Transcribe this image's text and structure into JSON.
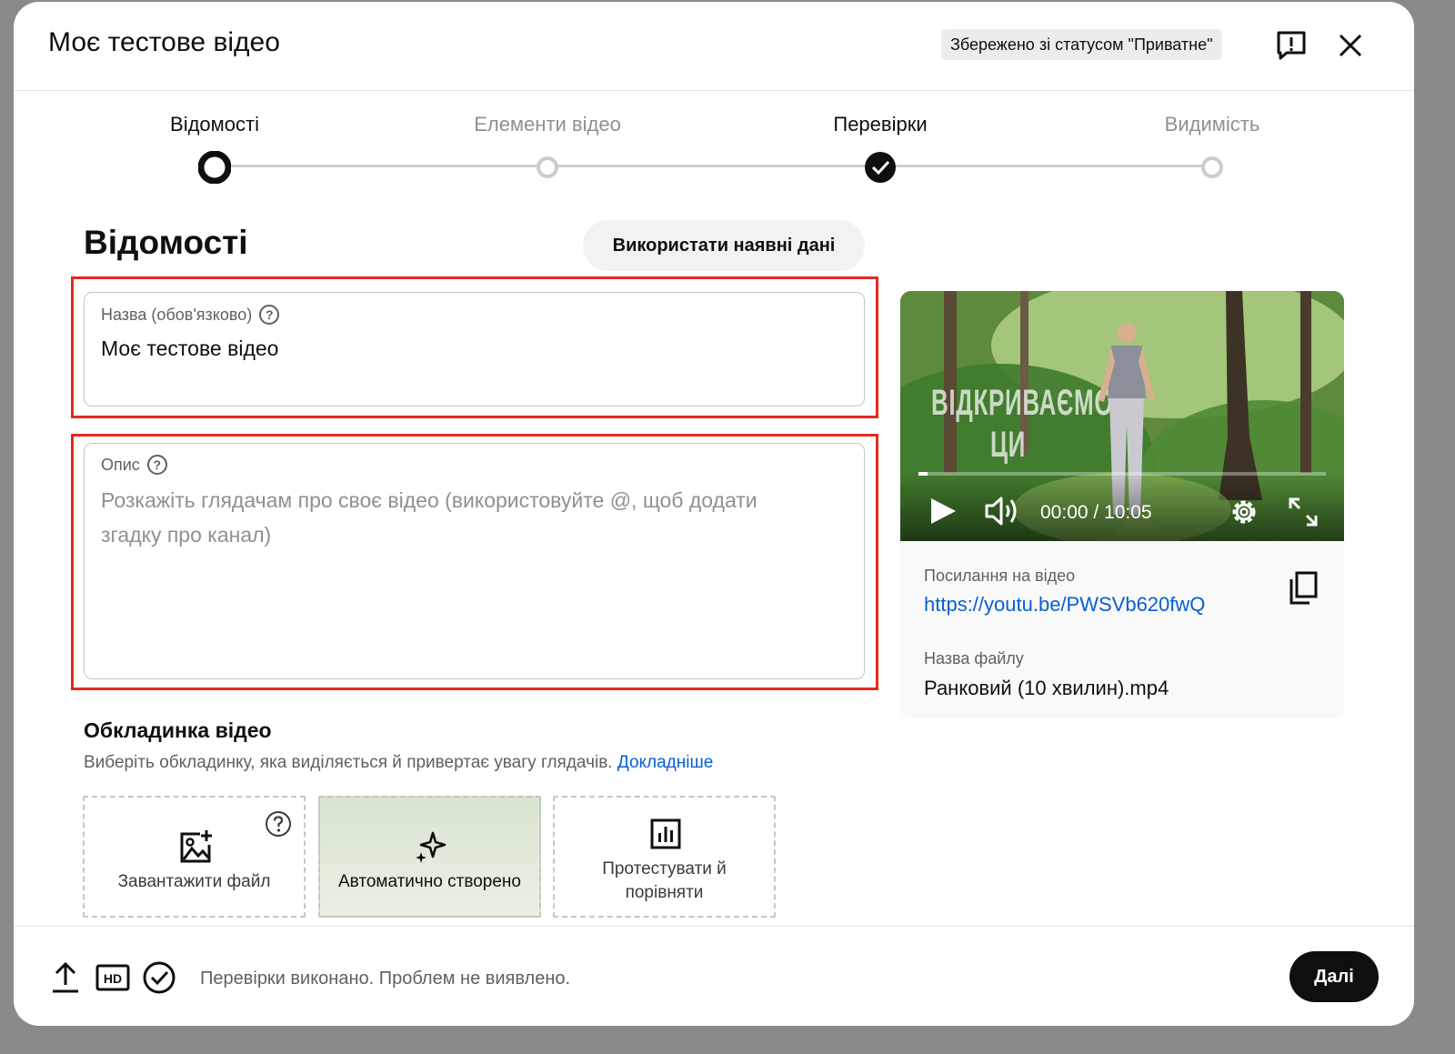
{
  "header": {
    "title": "Моє тестове відео",
    "saved_status": "Збережено зі статусом \"Приватне\""
  },
  "steps": [
    {
      "label": "Відомості",
      "state": "current"
    },
    {
      "label": "Елементи відео",
      "state": "pending"
    },
    {
      "label": "Перевірки",
      "state": "done"
    },
    {
      "label": "Видимість",
      "state": "pending"
    }
  ],
  "details": {
    "title": "Відомості",
    "use_existing_button": "Використати наявні дані",
    "title_field": {
      "label": "Назва (обов'язково)",
      "value": "Моє тестове відео"
    },
    "description_field": {
      "label": "Опис",
      "placeholder": "Розкажіть глядачам про своє відео (використовуйте @, щоб додати згадку про канал)"
    }
  },
  "thumbnail": {
    "title": "Обкладинка відео",
    "description": "Виберіть обкладинку, яка виділяється й привертає увагу глядачів.",
    "learn_more": "Докладніше",
    "options": [
      "Завантажити файл",
      "Автоматично створено",
      "Протестувати й порівняти"
    ]
  },
  "preview": {
    "overlay_text": "ВІДКРИВАЄМО ЦИ",
    "time": "00:00 / 10:05",
    "link_label": "Посилання на відео",
    "link": "https://youtu.be/PWSVb620fwQ",
    "file_label": "Назва файлу",
    "file_name": "Ранковий (10 хвилин).mp4"
  },
  "footer": {
    "status": "Перевірки виконано. Проблем не виявлено.",
    "next_button": "Далі"
  },
  "colors": {
    "highlight": "#e32a1e",
    "link": "#065fd4",
    "primary_button": "#0f0f0f"
  }
}
